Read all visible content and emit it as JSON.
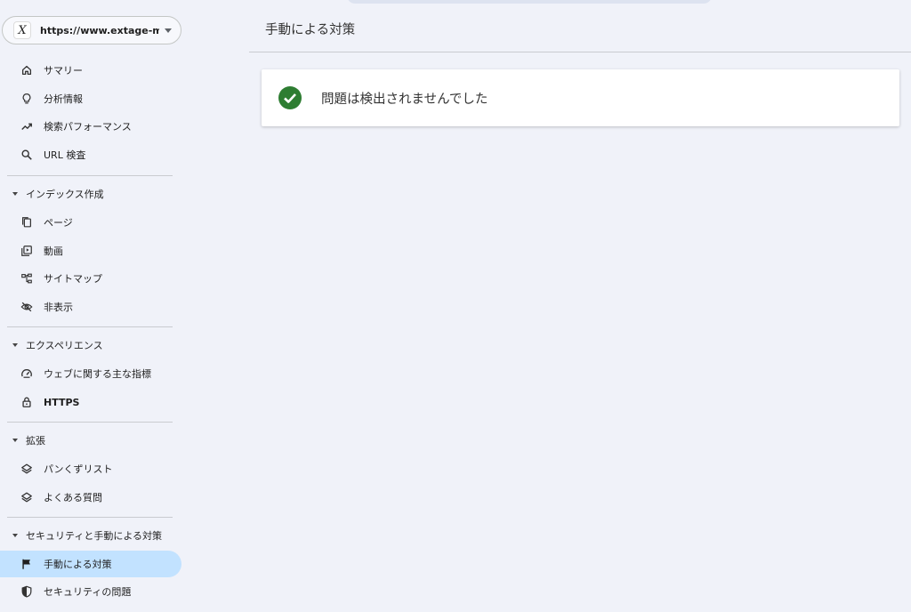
{
  "property": {
    "url": "https://www.extage-ma…",
    "logo": "X",
    "logo_icon": "x-logo-icon"
  },
  "nav": {
    "summary": "サマリー",
    "insights": "分析情報",
    "performance": "検索パフォーマンス",
    "url_inspection": "URL 検査",
    "indexing": "インデックス作成",
    "pages": "ページ",
    "videos": "動画",
    "sitemaps": "サイトマップ",
    "removals": "非表示",
    "experience": "エクスペリエンス",
    "core_web_vitals": "ウェブに関する主な指標",
    "https": "HTTPS",
    "enhancements": "拡張",
    "breadcrumbs": "パンくずリスト",
    "faq": "よくある質問",
    "security_manual": "セキュリティと手動による対策",
    "manual_actions": "手動による対策",
    "security_issues": "セキュリティの問題"
  },
  "main": {
    "title": "手動による対策",
    "status_message": "問題は検出されませんでした",
    "status_color": "#2e7d32"
  },
  "colors": {
    "active_bg": "#c2e2ff",
    "page_bg": "#f0f2f9"
  }
}
